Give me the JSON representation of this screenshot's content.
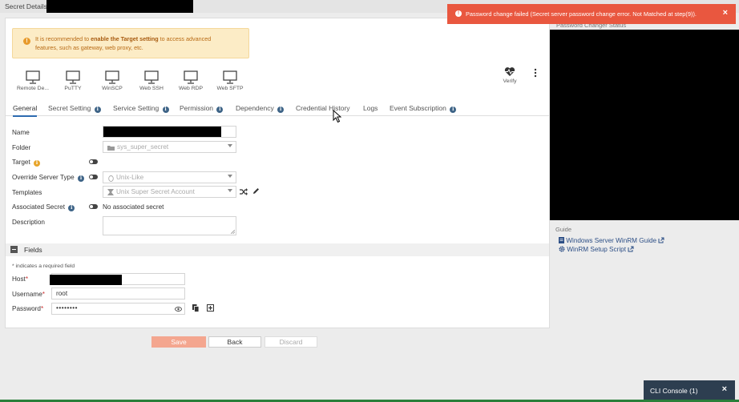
{
  "window": {
    "title": "Secret Details"
  },
  "warning": {
    "icon": "exclamation-icon",
    "prefix": "It is recommended to ",
    "bold": "enable the Target setting",
    "line1_suffix": " to access advanced",
    "line2": "features, such as gateway, web proxy, etc."
  },
  "launchers": [
    {
      "label": "Remote De...",
      "icon": "monitor-icon"
    },
    {
      "label": "PuTTY",
      "icon": "monitor-icon"
    },
    {
      "label": "WinSCP",
      "icon": "monitor-icon"
    },
    {
      "label": "Web SSH",
      "icon": "monitor-icon"
    },
    {
      "label": "Web RDP",
      "icon": "monitor-icon"
    },
    {
      "label": "Web SFTP",
      "icon": "monitor-icon"
    }
  ],
  "verify": {
    "label": "Verify",
    "icon": "heartbeat-icon"
  },
  "tabs": [
    {
      "label": "General",
      "active": true
    },
    {
      "label": "Secret Setting",
      "info": true
    },
    {
      "label": "Service Setting",
      "info": true
    },
    {
      "label": "Permission",
      "info": true
    },
    {
      "label": "Dependency",
      "info": true
    },
    {
      "label": "Credential History"
    },
    {
      "label": "Logs"
    },
    {
      "label": "Event Subscription",
      "info": true
    }
  ],
  "form": {
    "name_label": "Name",
    "folder_label": "Folder",
    "folder_value": "sys_super_secret",
    "target_label": "Target",
    "override_label": "Override Server Type",
    "override_value": "Unix-Like",
    "templates_label": "Templates",
    "templates_value": "Unix Super Secret Account",
    "associated_label": "Associated Secret",
    "associated_value": "No associated secret",
    "description_label": "Description"
  },
  "fields": {
    "header": "Fields",
    "required_note": "* indicates a required field",
    "host_label": "Host",
    "username_label": "Username",
    "username_value": "root",
    "password_label": "Password",
    "password_value": "••••••••",
    "required_mark": "*"
  },
  "buttons": {
    "save": "Save",
    "back": "Back",
    "discard": "Discard"
  },
  "right": {
    "status_title": "Password Changer Status",
    "guide_title": "Guide",
    "links": [
      {
        "label": "Windows Server WinRM Guide",
        "icon": "document-icon"
      },
      {
        "label": "WinRM Setup Script",
        "icon": "gear-icon"
      }
    ]
  },
  "toast": {
    "message": "Password change failed (Secret server password change error. Not Matched at step(9)).",
    "color": "#e9573f"
  },
  "cli": {
    "label": "CLI Console (1)"
  },
  "colors": {
    "accent": "#2d6bb0",
    "save": "#f4a68f",
    "warning_bg": "#fcecc6"
  }
}
